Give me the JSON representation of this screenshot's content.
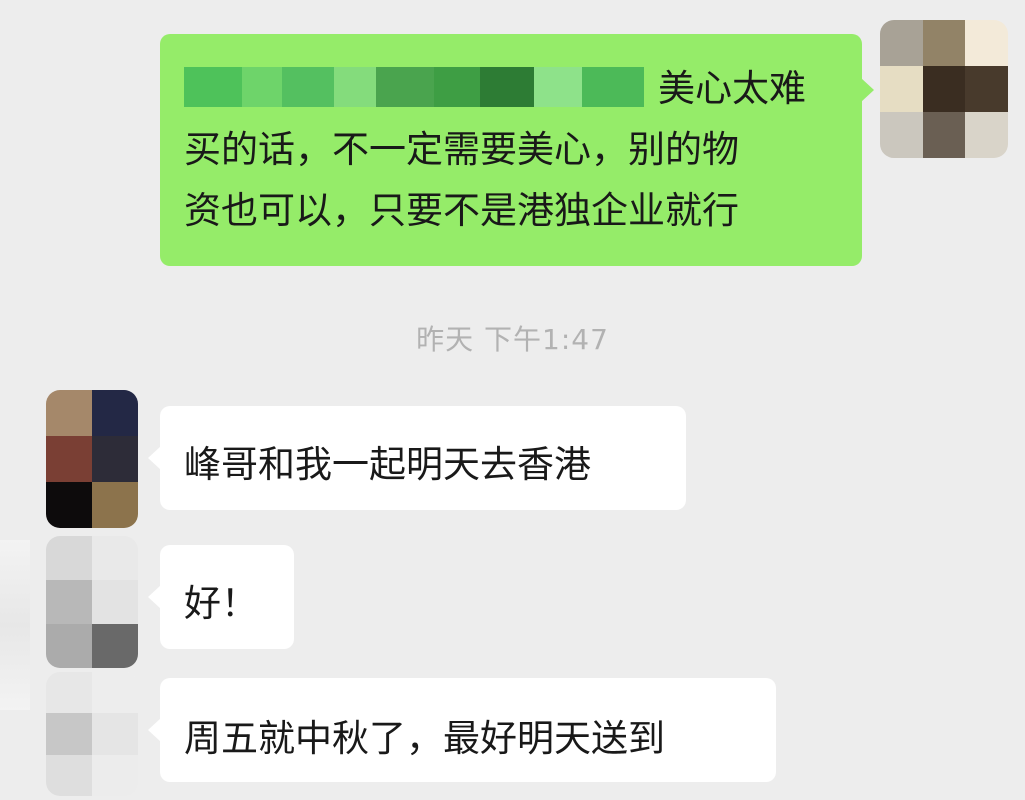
{
  "chat": {
    "timestamp": "昨天 下午1:47",
    "outgoing": {
      "mention_tail": "美心太难",
      "line2": "买的话，不一定需要美心，别的物",
      "line3": "资也可以，只要不是港独企业就行"
    },
    "incoming": [
      {
        "text": "峰哥和我一起明天去香港"
      },
      {
        "text": "好！"
      },
      {
        "text": "周五就中秋了，最好明天送到"
      }
    ]
  },
  "colors": {
    "background": "#ededed",
    "outgoing_bubble": "#95ec69",
    "incoming_bubble": "#ffffff",
    "timestamp_text": "#b2b2b2",
    "message_text": "#191919"
  },
  "icons": {
    "self_avatar": "pixelated-avatar-icon",
    "contact_avatar": "pixelated-avatar-icon"
  }
}
